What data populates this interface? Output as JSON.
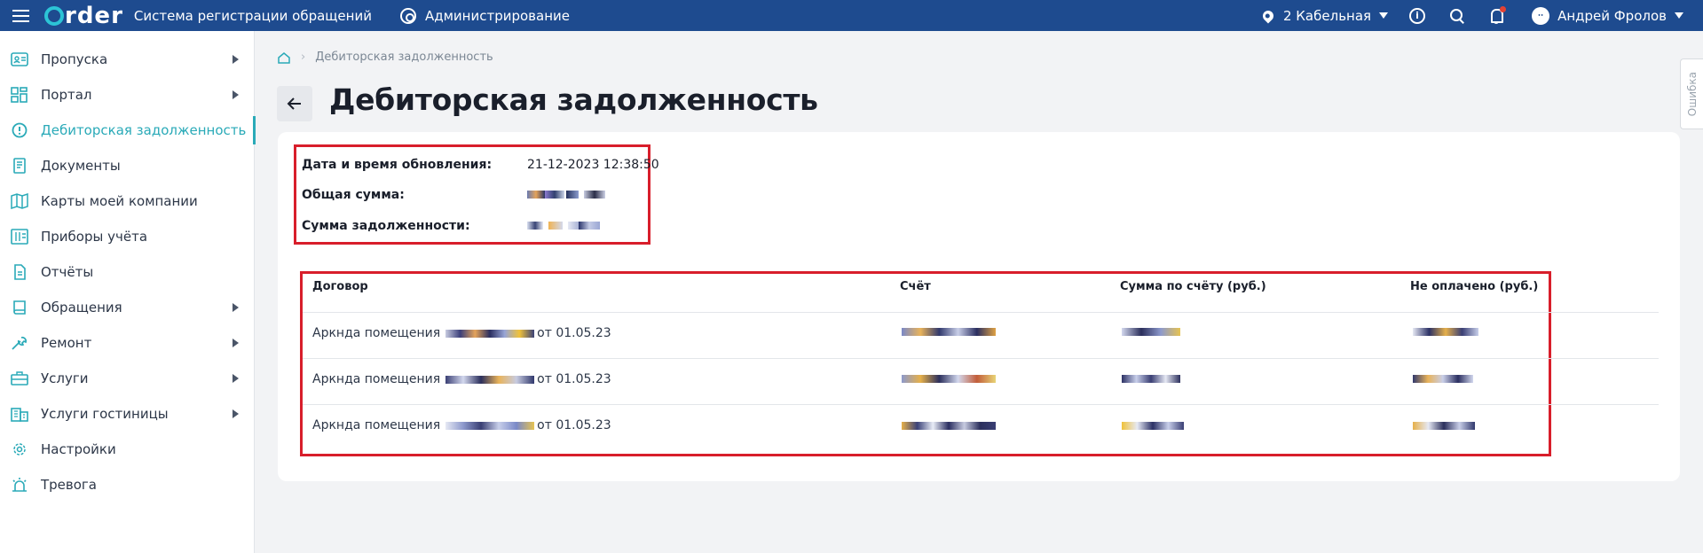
{
  "topbar": {
    "logo": "rder",
    "app_title": "Система регистрации обращений",
    "admin_label": "Администрирование",
    "location": "2 Кабельная",
    "user_name": "Андрей Фролов"
  },
  "sidebar": {
    "items": [
      {
        "label": "Пропуска",
        "icon": "pass-card-icon",
        "has_submenu": true
      },
      {
        "label": "Портал",
        "icon": "grid-icon",
        "has_submenu": true
      },
      {
        "label": "Дебиторская задолженность",
        "icon": "alert-circle-icon",
        "active": true
      },
      {
        "label": "Документы",
        "icon": "document-icon"
      },
      {
        "label": "Карты моей компании",
        "icon": "map-icon"
      },
      {
        "label": "Приборы учёта",
        "icon": "meter-icon"
      },
      {
        "label": "Отчёты",
        "icon": "report-icon"
      },
      {
        "label": "Обращения",
        "icon": "book-icon",
        "has_submenu": true
      },
      {
        "label": "Ремонт",
        "icon": "wrench-icon",
        "has_submenu": true
      },
      {
        "label": "Услуги",
        "icon": "briefcase-icon",
        "has_submenu": true
      },
      {
        "label": "Услуги гостиницы",
        "icon": "hotel-icon",
        "has_submenu": true
      },
      {
        "label": "Настройки",
        "icon": "gear-icon"
      },
      {
        "label": "Тревога",
        "icon": "alarm-icon"
      }
    ]
  },
  "breadcrumb": {
    "current": "Дебиторская задолженность"
  },
  "page_title": "Дебиторская задолженность",
  "summary": {
    "updated_label": "Дата и время обновления:",
    "updated_value": "21-12-2023 12:38:50",
    "total_label": "Общая сумма:",
    "debt_label": "Сумма задолженности:"
  },
  "table": {
    "headers": [
      "Договор",
      "Счёт",
      "Сумма по счёту (руб.)",
      "Не оплачено (руб.)"
    ],
    "rows": [
      {
        "contract_prefix": "Аркнда помещения",
        "contract_suffix": "от 01.05.23"
      },
      {
        "contract_prefix": "Аркнда помещения",
        "contract_suffix": "от 01.05.23"
      },
      {
        "contract_prefix": "Аркнда помещения",
        "contract_suffix": "от 01.05.23"
      }
    ]
  },
  "side_tab": "Ошибка",
  "colors": {
    "topbar": "#1e4b8f",
    "accent": "#2aaab8",
    "highlight_border": "#d81e2b"
  }
}
